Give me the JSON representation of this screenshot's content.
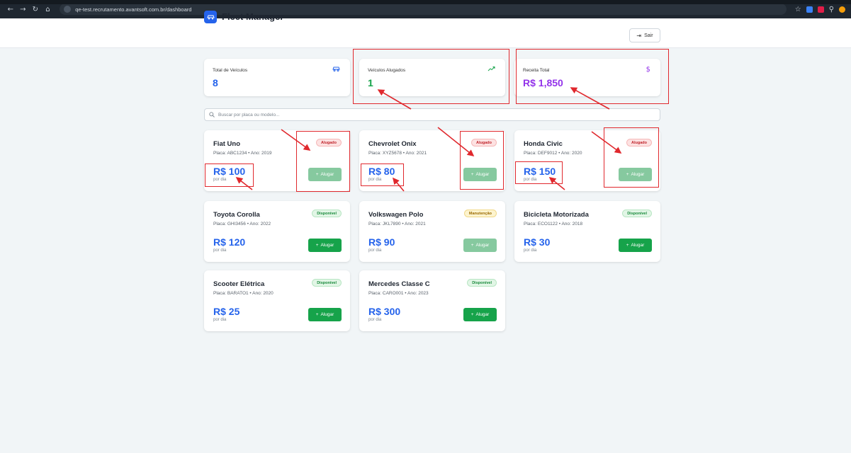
{
  "browser": {
    "url": "qe-test.recrutamento.avantsoft.com.br/dashboard"
  },
  "header": {
    "title": "Fleet Manager",
    "logout_label": "Sair"
  },
  "stats": [
    {
      "label": "Total de Veículos",
      "value": "8",
      "icon": "car-icon",
      "color": "#2563eb"
    },
    {
      "label": "Veículos Alugados",
      "value": "1",
      "icon": "trending-up-icon",
      "color": "#16a34a"
    },
    {
      "label": "Receita Total",
      "value": "R$ 1,850",
      "icon": "dollar-icon",
      "color": "#9333ea"
    }
  ],
  "search": {
    "placeholder": "Buscar por placa ou modelo..."
  },
  "vehicles": [
    {
      "name": "Fiat Uno",
      "plate": "Placa: ABC1234 • Ano: 2019",
      "price": "R$ 100",
      "per": "por dia",
      "status": "Alugado",
      "button": "Alugar"
    },
    {
      "name": "Chevrolet Onix",
      "plate": "Placa: XYZ5678 • Ano: 2021",
      "price": "R$ 80",
      "per": "por dia",
      "status": "Alugado",
      "button": "Alugar"
    },
    {
      "name": "Honda Civic",
      "plate": "Placa: DEF9012 • Ano: 2020",
      "price": "R$ 150",
      "per": "por dia",
      "status": "Alugado",
      "button": "Alugar"
    },
    {
      "name": "Toyota Corolla",
      "plate": "Placa: GHI3456 • Ano: 2022",
      "price": "R$ 120",
      "per": "por dia",
      "status": "Disponível",
      "button": "Alugar"
    },
    {
      "name": "Volkswagen Polo",
      "plate": "Placa: JKL7890 • Ano: 2021",
      "price": "R$ 90",
      "per": "por dia",
      "status": "Manutenção",
      "button": "Alugar"
    },
    {
      "name": "Bicicleta Motorizada",
      "plate": "Placa: ECO1122 • Ano: 2018",
      "price": "R$ 30",
      "per": "por dia",
      "status": "Disponível",
      "button": "Alugar"
    },
    {
      "name": "Scooter Elétrica",
      "plate": "Placa: BARATO1 • Ano: 2020",
      "price": "R$ 25",
      "per": "por dia",
      "status": "Disponível",
      "button": "Alugar"
    },
    {
      "name": "Mercedes Classe C",
      "plate": "Placa: CARO001 • Ano: 2023",
      "price": "R$ 300",
      "per": "por dia",
      "status": "Disponível",
      "button": "Alugar"
    }
  ],
  "colors": {
    "accent": "#2563eb",
    "success": "#16a34a",
    "annotation": "#e0282d"
  }
}
